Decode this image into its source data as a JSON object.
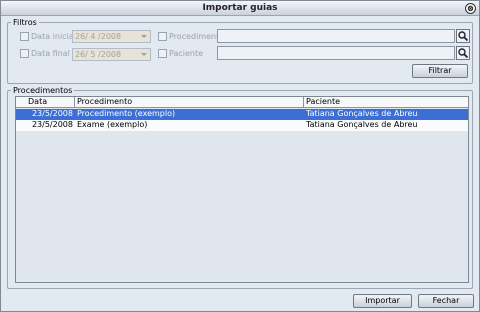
{
  "window": {
    "title": "Importar guias",
    "close_glyph": "⊗"
  },
  "filters": {
    "legend": "Filtros",
    "start_date": {
      "label": "Data inicial",
      "value": "26/ 4 /2008",
      "checked": false
    },
    "end_date": {
      "label": "Data final",
      "value": "26/ 5 /2008",
      "checked": false
    },
    "procedure": {
      "label": "Procedimento",
      "value": "",
      "checked": false
    },
    "patient": {
      "label": "Paciente",
      "value": "",
      "checked": false
    },
    "filter_button": "Filtrar"
  },
  "procedures": {
    "legend": "Procedimentos",
    "columns": [
      "Data",
      "Procedimento",
      "Paciente"
    ],
    "rows": [
      {
        "date": "23/5/2008",
        "procedure": "Procedimento (exemplo)",
        "patient": "Tatiana Gonçalves de Abreu",
        "selected": true
      },
      {
        "date": "23/5/2008",
        "procedure": "Exame (exemplo)",
        "patient": "Tatiana Gonçalves de Abreu",
        "selected": false
      }
    ]
  },
  "footer": {
    "import_button": "Importar",
    "close_button": "Fechar"
  },
  "colors": {
    "selection": "#3c6fd6",
    "window_bg": "#e3e9f0"
  }
}
